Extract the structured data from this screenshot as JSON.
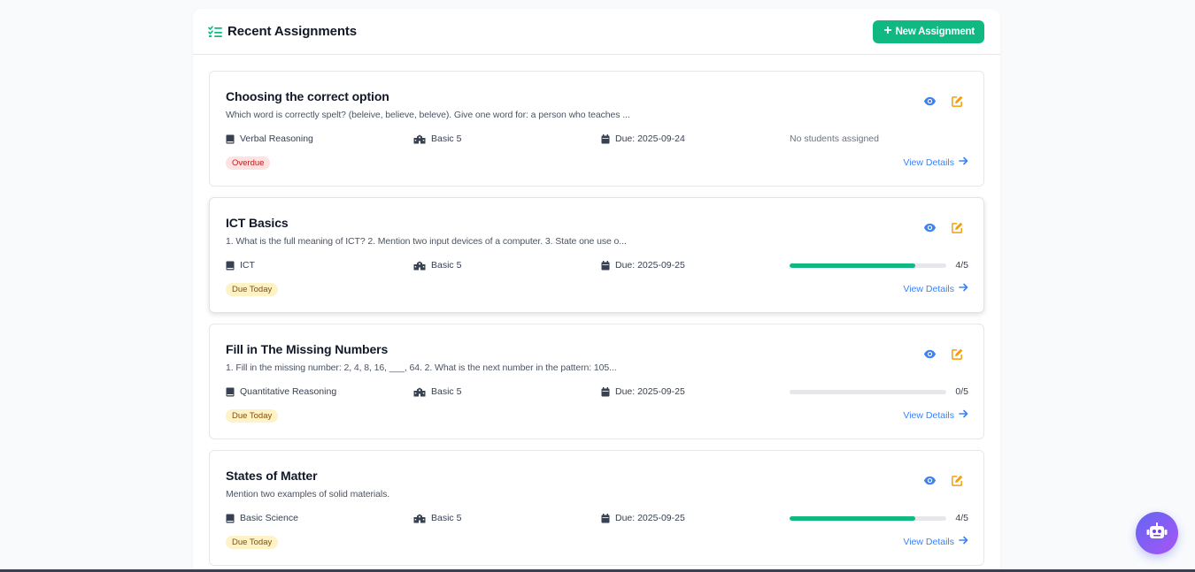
{
  "header": {
    "title": "Recent Assignments",
    "new_button_label": "New Assignment",
    "accent": "#10b981"
  },
  "assignments": [
    {
      "title": "Choosing the correct option",
      "description": "Which word is correctly spelt? (beleive, believe, beleve). Give one word for: a person who teaches ...",
      "subject": "Verbal Reasoning",
      "class": "Basic 5",
      "due": "Due: 2025-09-24",
      "students": "No students assigned",
      "status": "Overdue",
      "view_label": "View Details"
    },
    {
      "title": "ICT Basics",
      "description": "1. What is the full meaning of ICT? 2. Mention two input devices of a computer. 3. State one use o...",
      "subject": "ICT",
      "class": "Basic 5",
      "due": "Due: 2025-09-25",
      "progress_text": "4/5",
      "progress": 0.8,
      "status": "Due Today",
      "view_label": "View Details"
    },
    {
      "title": "Fill in The Missing Numbers",
      "description": "1. Fill in the missing number: 2, 4, 8, 16, ___, 64. 2. What is the next number in the pattern: 105...",
      "subject": "Quantitative Reasoning",
      "class": "Basic 5",
      "due": "Due: 2025-09-25",
      "progress_text": "0/5",
      "progress": 0,
      "status": "Due Today",
      "view_label": "View Details"
    },
    {
      "title": "States of Matter",
      "description": "Mention two examples of solid materials.",
      "subject": "Basic Science",
      "class": "Basic 5",
      "due": "Due: 2025-09-25",
      "progress_text": "4/5",
      "progress": 0.8,
      "status": "Due Today",
      "view_label": "View Details"
    }
  ],
  "icons": {
    "header": "tasks-icon",
    "subject": "book-icon",
    "class": "school-icon",
    "due": "calendar-icon",
    "view": "eye-icon",
    "edit": "edit-icon",
    "details": "arrow-right-icon",
    "assistant": "robot-icon"
  },
  "colors": {
    "overdue_bg": "#fee2e2",
    "overdue_text": "#b91c1c",
    "due_today_bg": "#fef3c7",
    "due_today_text": "#854d0e",
    "link": "#3b82f6",
    "edit": "#f59e0b"
  }
}
